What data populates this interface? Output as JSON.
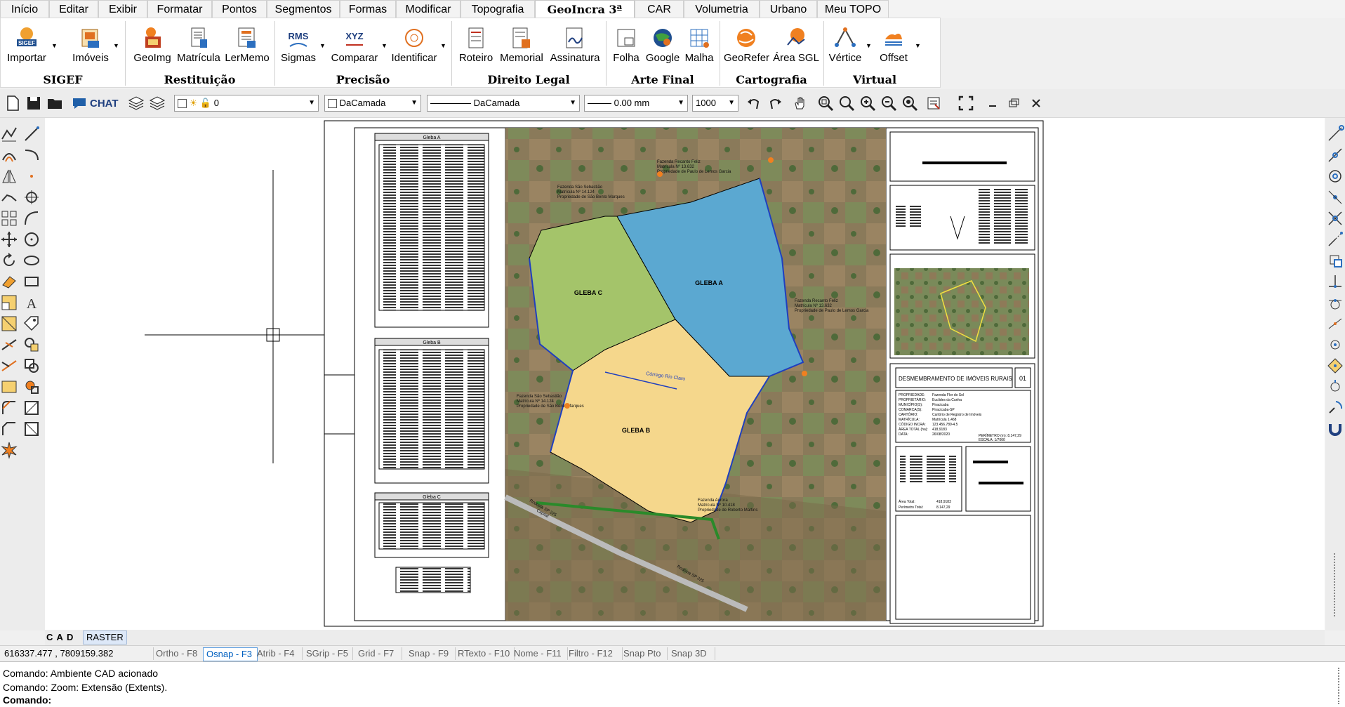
{
  "menu": {
    "tabs": [
      "Início",
      "Editar",
      "Exibir",
      "Formatar",
      "Pontos",
      "Segmentos",
      "Formas",
      "Modificar",
      "Topografia",
      "GeoIncra 3ª Ed.",
      "CAR",
      "Volumetria",
      "Urbano",
      "Meu TOPO"
    ],
    "active": "GeoIncra 3ª Ed."
  },
  "ribbon": {
    "buttons": [
      "Importar",
      "Imóveis",
      "GeoImg",
      "Matrícula",
      "LerMemo",
      "Sigmas",
      "Comparar",
      "Identificar",
      "Roteiro",
      "Memorial",
      "Assinatura",
      "Folha",
      "Google",
      "Malha",
      "GeoRefer",
      "Área SGL",
      "Vértice",
      "Offset"
    ],
    "icon_texts": {
      "sigef": "SIGEF",
      "rms": "RMS",
      "xyz": "XYZ"
    },
    "groups": [
      "SIGEF",
      "Restituição",
      "Precisão",
      "Direito Legal",
      "Arte Final",
      "Cartografia",
      "Virtual"
    ]
  },
  "toolbar": {
    "chat_label": "CHAT",
    "layer_value": "0",
    "color_value": "DaCamada",
    "linetype_value": "DaCamada",
    "lineweight_value": "0.00 mm",
    "scale_value": "1000"
  },
  "drawing": {
    "labels": {
      "gleba_a": "GLEBA A",
      "gleba_b": "GLEBA B",
      "gleba_c": "GLEBA C",
      "corrego": "Córrego Rio Claro",
      "faz_recanto": "Fazenda Recanto Feliz",
      "faz_recanto_mat": "Matrícula Nº 13.632",
      "faz_recanto_prop": "Propriedade de Paulo de Lemos Garcia",
      "faz_sao_seb": "Fazenda São Sebastião",
      "faz_sao_seb_mat": "Matrícula Nº 14.124",
      "faz_sao_seb_prop": "Propriedade de São Bento Marques",
      "faz_aurora": "Fazenda Aurora",
      "faz_aurora_mat": "Matrícula Nº 10.418",
      "faz_aurora_prop": "Propriedade de Roberto Martins",
      "rodovia": "Rodovia SP 225",
      "capital": "Capital"
    },
    "table_titles": [
      "Gleba A",
      "Gleba B",
      "Gleba C"
    ],
    "title_block": {
      "heading": "DESMEMBRAMENTO DE IMÓVEIS RURAIS",
      "sheet": "01",
      "fields": [
        [
          "PROPRIEDADE:",
          "Fazenda Flor do Sol"
        ],
        [
          "PROPRIETÁRIO:",
          "Euclides da Cunha"
        ],
        [
          "MUNICÍPIO(S):",
          "Piracicaba"
        ],
        [
          "COMARCA(S):",
          "Piracicaba-SP"
        ],
        [
          "CARTÓRIO:",
          "Cartório de Registro de Imóveis"
        ],
        [
          "MATRÍCULA:",
          "Matrícula 1.468"
        ],
        [
          "CÓDIGO INCRA:",
          "123.456.789-4.5"
        ],
        [
          "ÁREA TOTAL (ha):",
          "418,9183"
        ],
        [
          "DATA:",
          "26/08/2020"
        ]
      ],
      "perimeter": "PERÍMETRO (m): 8.147,29",
      "scale": "ESCALA: 1/7000",
      "area_total_label": "Área Total:",
      "area_total_value": "418,9183",
      "perimetro_total_label": "Perímetro Total:",
      "perimetro_total_value": "8.147,29"
    }
  },
  "canvas_tabs": {
    "cad": "C A D",
    "raster": "RASTER"
  },
  "status": {
    "coords": "616337.477 , 7809159.382",
    "items": [
      "Ortho - F8",
      "Osnap - F3",
      "Atrib - F4",
      "SGrip - F5",
      "Grid - F7",
      "Snap - F9",
      "RTexto - F10",
      "Nome - F11",
      "Filtro - F12",
      "Snap Pto",
      "Snap 3D"
    ],
    "active": "Osnap - F3"
  },
  "command": {
    "lines": [
      "Comando: Ambiente CAD acionado",
      "Comando: Zoom: Extensão (Extents)."
    ],
    "prompt": "Comando:"
  },
  "colors": {
    "gleba_a": "#5ba8d1",
    "gleba_b": "#f5d78c",
    "gleba_c": "#a4c46a",
    "accent": "#1f5fa8"
  }
}
